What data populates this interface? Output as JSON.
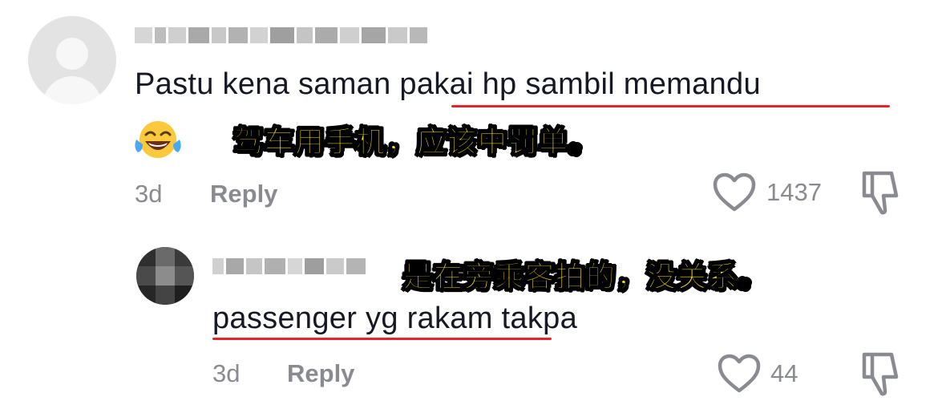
{
  "comments": [
    {
      "text_before": "Pastu kena saman ",
      "text_underlined": "pakai hp sambil memandu",
      "annotation": "驾车用手机，应该中罚单。",
      "emoji_icon": "face-with-tears-of-joy",
      "age": "3d",
      "reply_label": "Reply",
      "like_count": "1437"
    },
    {
      "annotation": "是在旁乘客拍的，没关系。",
      "text_underlined": "passenger yg rakam",
      "text_after": " takpa",
      "age": "3d",
      "reply_label": "Reply",
      "like_count": "44"
    }
  ],
  "colors": {
    "underline": "#e5232b",
    "annotation_fill": "#ffe600",
    "meta_gray": "#8a8b91"
  }
}
